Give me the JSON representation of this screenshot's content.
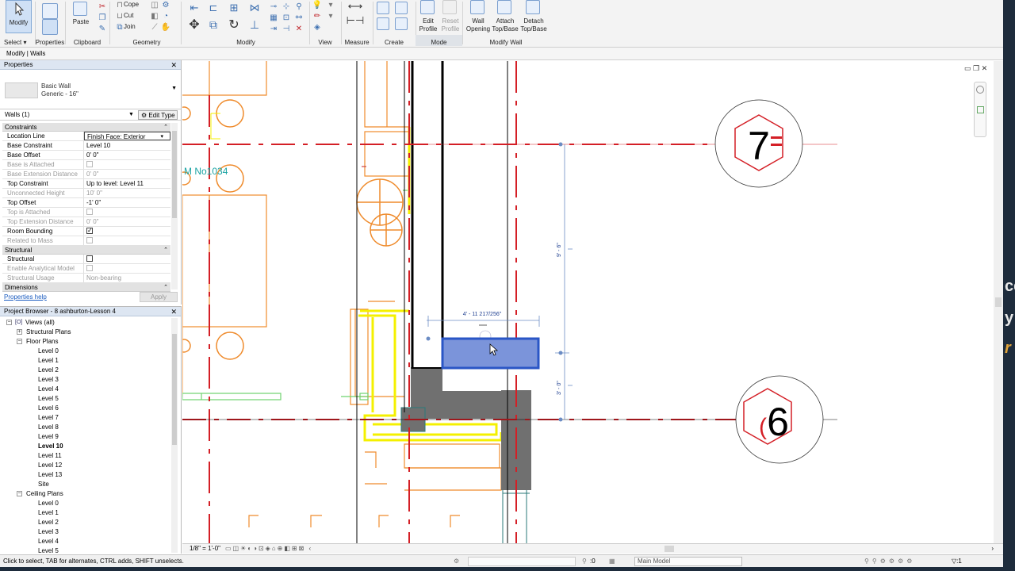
{
  "ribbon": {
    "select_panel": {
      "modify_label": "Modify",
      "title": "Select",
      "dropdown": "▾"
    },
    "properties_panel": {
      "title": "Properties"
    },
    "clipboard_panel": {
      "paste_label": "Paste",
      "title": "Clipboard"
    },
    "geometry_panel": {
      "cope_label": "Cope",
      "cut_label": "Cut",
      "join_label": "Join",
      "title": "Geometry"
    },
    "modify_panel": {
      "title": "Modify"
    },
    "view_panel": {
      "title": "View"
    },
    "measure_panel": {
      "title": "Measure"
    },
    "create_panel": {
      "title": "Create"
    },
    "mode_panel": {
      "edit_profile": [
        "Edit",
        "Profile"
      ],
      "reset_profile": [
        "Reset",
        "Profile"
      ],
      "title": "Mode"
    },
    "modify_wall_panel": {
      "wall_opening": [
        "Wall",
        "Opening"
      ],
      "attach": [
        "Attach",
        "Top/Base"
      ],
      "detach": [
        "Detach",
        "Top/Base"
      ],
      "title": "Modify Wall"
    }
  },
  "options_bar": {
    "context": "Modify | Walls"
  },
  "properties": {
    "header": "Properties",
    "type_name": "Basic Wall",
    "type_sub": "Generic - 16\"",
    "instance_filter": "Walls (1)",
    "edit_type": "Edit Type",
    "groups": [
      {
        "name": "Constraints",
        "rows": [
          {
            "key": "Location Line",
            "value": "Finish Face: Exterior",
            "state": "boxed"
          },
          {
            "key": "Base Constraint",
            "value": "Level 10",
            "state": "normal"
          },
          {
            "key": "Base Offset",
            "value": "0'  0\"",
            "state": "normal"
          },
          {
            "key": "Base is Attached",
            "value": "",
            "state": "dim-cb"
          },
          {
            "key": "Base Extension Distance",
            "value": "0'  0\"",
            "state": "dim"
          },
          {
            "key": "Top Constraint",
            "value": "Up to level: Level 11",
            "state": "normal"
          },
          {
            "key": "Unconnected Height",
            "value": "10'  0\"",
            "state": "dim"
          },
          {
            "key": "Top Offset",
            "value": "-1'  0\"",
            "state": "normal"
          },
          {
            "key": "Top is Attached",
            "value": "",
            "state": "dim-cb"
          },
          {
            "key": "Top Extension Distance",
            "value": "0'  0\"",
            "state": "dim"
          },
          {
            "key": "Room Bounding",
            "value": "✓",
            "state": "checked"
          },
          {
            "key": "Related to Mass",
            "value": "",
            "state": "dim-cb"
          }
        ]
      },
      {
        "name": "Structural",
        "rows": [
          {
            "key": "Structural",
            "value": "",
            "state": "cb"
          },
          {
            "key": "Enable Analytical Model",
            "value": "",
            "state": "dim-cb"
          },
          {
            "key": "Structural Usage",
            "value": "Non-bearing",
            "state": "dim"
          }
        ]
      },
      {
        "name": "Dimensions",
        "rows": []
      }
    ],
    "help_link": "Properties help",
    "apply": "Apply"
  },
  "project_browser": {
    "header": "Project Browser - 8 ashburton-Lesson 4",
    "items": [
      {
        "label": "Views (all)",
        "indent": 0,
        "toggle": "−",
        "icon": "[O]"
      },
      {
        "label": "Structural Plans",
        "indent": 1,
        "toggle": "+"
      },
      {
        "label": "Floor Plans",
        "indent": 1,
        "toggle": "−"
      },
      {
        "label": "Level 0",
        "indent": 2
      },
      {
        "label": "Level 1",
        "indent": 2
      },
      {
        "label": "Level 2",
        "indent": 2
      },
      {
        "label": "Level 3",
        "indent": 2
      },
      {
        "label": "Level 4",
        "indent": 2
      },
      {
        "label": "Level 5",
        "indent": 2
      },
      {
        "label": "Level 6",
        "indent": 2
      },
      {
        "label": "Level 7",
        "indent": 2
      },
      {
        "label": "Level 8",
        "indent": 2
      },
      {
        "label": "Level 9",
        "indent": 2
      },
      {
        "label": "Level 10",
        "indent": 2,
        "bold": true
      },
      {
        "label": "Level 11",
        "indent": 2
      },
      {
        "label": "Level 12",
        "indent": 2
      },
      {
        "label": "Level 13",
        "indent": 2
      },
      {
        "label": "Site",
        "indent": 2
      },
      {
        "label": "Ceiling Plans",
        "indent": 1,
        "toggle": "−"
      },
      {
        "label": "Level 0",
        "indent": 2
      },
      {
        "label": "Level 1",
        "indent": 2
      },
      {
        "label": "Level 2",
        "indent": 2
      },
      {
        "label": "Level 3",
        "indent": 2
      },
      {
        "label": "Level 4",
        "indent": 2
      },
      {
        "label": "Level 5",
        "indent": 2
      }
    ]
  },
  "canvas": {
    "grid_7": "7",
    "grid_6": "6",
    "room_tag": "M No1034",
    "temp_dim": "4' - 11 217/256\"",
    "dim_upper": "9' - 6\"",
    "dim_lower": "3' - 0\""
  },
  "view_control": {
    "scale": "1/8\" = 1'-0\""
  },
  "status_bar": {
    "message": "Click to select, TAB for alternates, CTRL adds, SHIFT unselects.",
    "zero": ":0",
    "model": "Main Model",
    "filter_count": ":1"
  },
  "overlay_text": [
    "ce",
    "y",
    "r"
  ],
  "colors": {
    "grid_red": "#d41f26",
    "selection_blue": "#2a56c6",
    "highlight_yellow": "#f4f000",
    "wall_orange": "#ef8b2c",
    "fill_gray": "#707070",
    "green": "#6fd36f"
  }
}
